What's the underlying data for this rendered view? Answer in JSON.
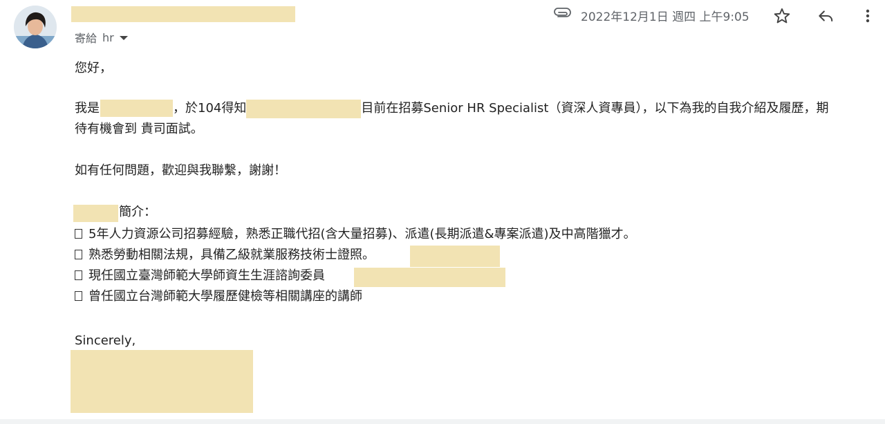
{
  "header": {
    "recipient_prefix": "寄給",
    "recipient_name": "hr",
    "date": "2022年12月1日 週四 上午9:05",
    "icons": {
      "attachment": "paperclip-icon",
      "star": "star-icon",
      "reply": "reply-icon",
      "more": "more-vertical-icon"
    }
  },
  "email": {
    "greeting": "您好，",
    "intro_part1": "我是",
    "intro_part2": "，於104得知",
    "intro_part3": "目前在招募Senior HR Specialist（資深人資專員），以下為我的自我介紹及履歷，期",
    "intro_line2": "待有機會到 貴司面試。",
    "contact": "如有任何問題，歡迎與我聯繫，謝謝！",
    "profile_suffix": "簡介：",
    "bullets": [
      "5年人力資源公司招募經驗，熟悉正職代招(含大量招募)、派遣(長期派遣&專案派遣)及中高階獵才。",
      "熟悉勞動相關法規，具備乙級就業服務技術士證照。",
      "現任國立臺灣師範大學師資生生涯諮詢委員",
      "曾任國立台灣師範大學履歷健檢等相關講座的講師"
    ],
    "closing": "Sincerely,"
  },
  "colors": {
    "redaction": "#f2e3b3",
    "meta_text": "#5f6368",
    "body_text": "#222222"
  }
}
